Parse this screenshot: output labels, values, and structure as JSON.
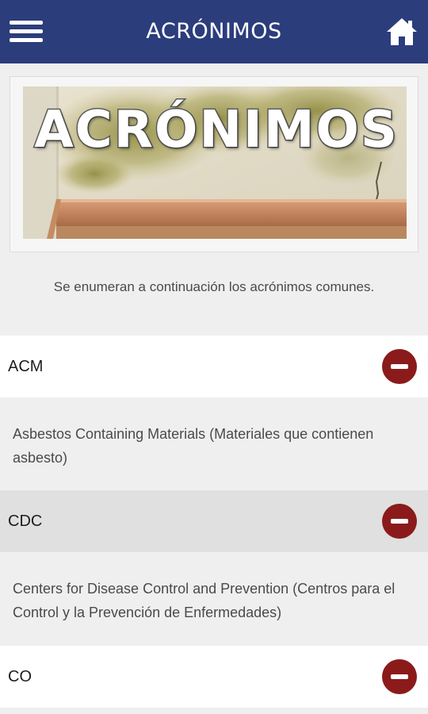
{
  "header": {
    "title": "ACRÓNIMOS",
    "color": "#2c3d7c"
  },
  "icons": {
    "menu": "menu-icon",
    "home": "home-icon",
    "collapse": "minus-circle-icon"
  },
  "banner": {
    "title": "ACRÓNIMOS"
  },
  "intro": {
    "text": "Se enumeran a continuación los acrónimos comunes."
  },
  "acronyms": [
    {
      "label": "ACM",
      "description": "Asbestos Containing Materials (Materiales que contienen asbesto)"
    },
    {
      "label": "CDC",
      "description": "Centers for Disease Control and Prevention (Centros para el Control y la Prevención de Enfermedades)"
    },
    {
      "label": "CO",
      "description": ""
    }
  ],
  "colors": {
    "collapse_button": "#8b1b1b",
    "background": "#efefef"
  }
}
